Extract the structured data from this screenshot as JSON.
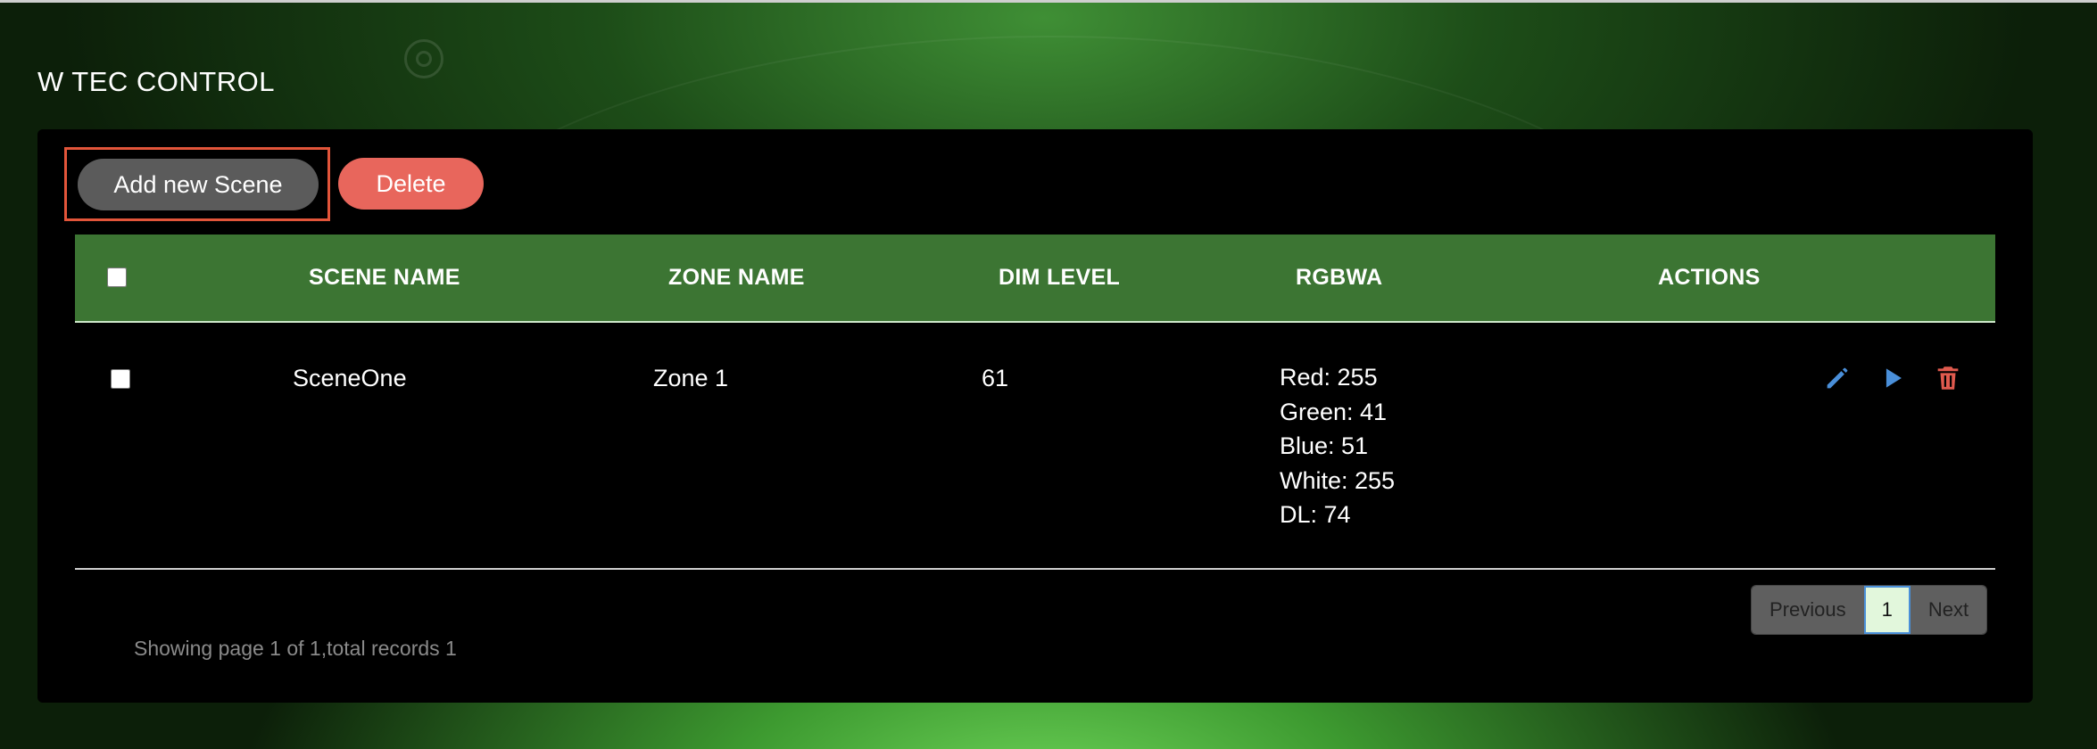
{
  "app": {
    "title": "W TEC CONTROL"
  },
  "toolbar": {
    "add_label": "Add new Scene",
    "delete_label": "Delete"
  },
  "table": {
    "headers": {
      "scene_name": "SCENE NAME",
      "zone_name": "ZONE NAME",
      "dim_level": "DIM LEVEL",
      "rgbwa": "RGBWA",
      "actions": "ACTIONS"
    },
    "rows": [
      {
        "scene_name": "SceneOne",
        "zone_name": "Zone 1",
        "dim_level": "61",
        "rgbwa": {
          "red": "Red: 255",
          "green": "Green: 41",
          "blue": "Blue: 51",
          "white": "White: 255",
          "dl": "DL: 74"
        },
        "actions": [
          "edit-icon",
          "play-icon",
          "trash-icon"
        ]
      }
    ]
  },
  "pagination": {
    "previous": "Previous",
    "current": "1",
    "next": "Next"
  },
  "status_text": "Showing page 1 of 1,total records 1",
  "colors": {
    "header_green": "#3c7533",
    "delete_red": "#e8665c",
    "add_gray": "#5b5b5b",
    "highlight_border": "#e2553a",
    "edit_blue": "#4a8fd9",
    "trash_red": "#e05a4e"
  }
}
